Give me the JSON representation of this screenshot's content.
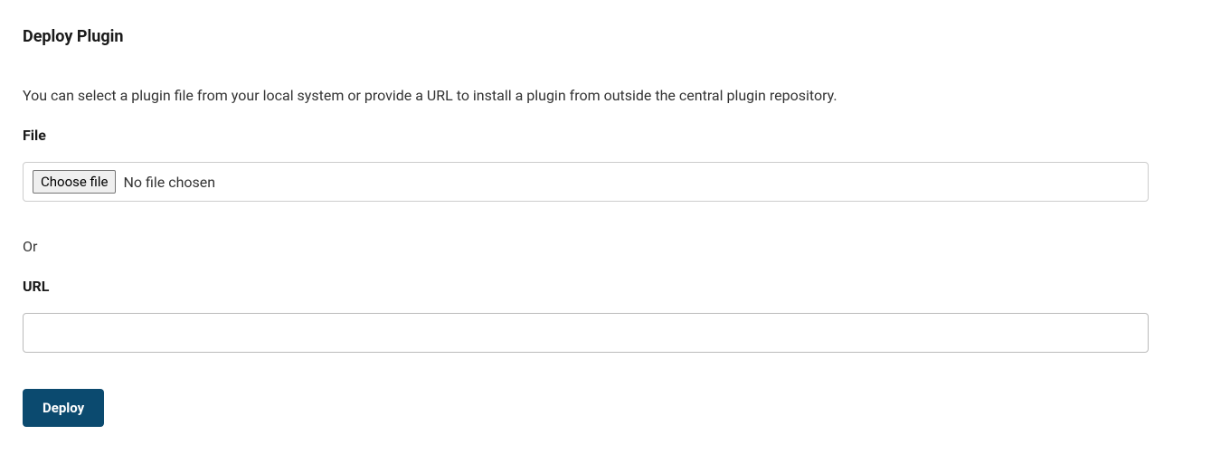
{
  "page": {
    "title": "Deploy Plugin",
    "description": "You can select a plugin file from your local system or provide a URL to install a plugin from outside the central plugin repository."
  },
  "file_field": {
    "label": "File",
    "choose_button": "Choose file",
    "status": "No file chosen"
  },
  "separator": "Or",
  "url_field": {
    "label": "URL",
    "value": ""
  },
  "actions": {
    "deploy_label": "Deploy"
  }
}
